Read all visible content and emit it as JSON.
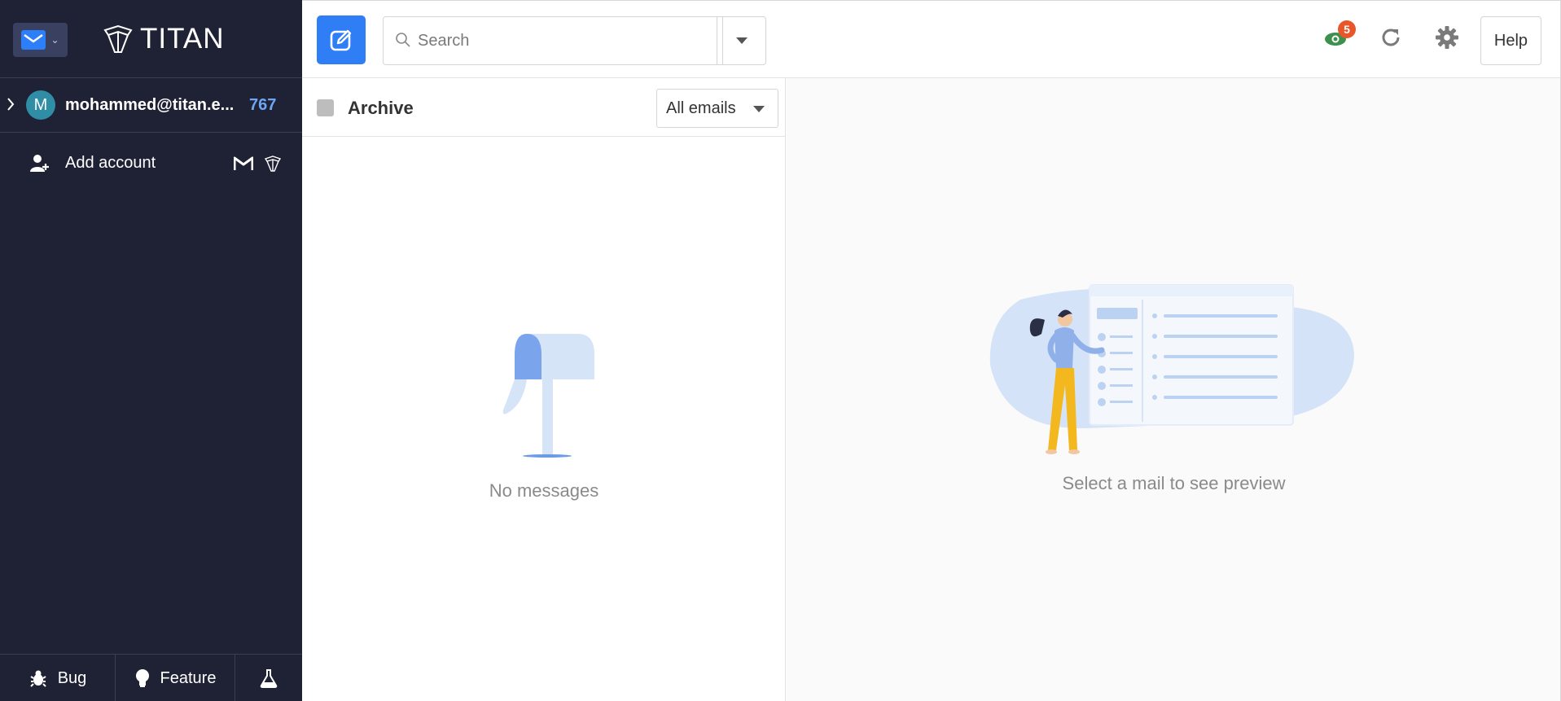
{
  "app": {
    "brand": "TITAN"
  },
  "sidebar": {
    "account": {
      "initial": "M",
      "email": "mohammed@titan.e...",
      "count": "767"
    },
    "add_account_label": "Add account",
    "bottom": {
      "bug_label": "Bug",
      "feature_label": "Feature"
    }
  },
  "header": {
    "search": {
      "placeholder": "Search",
      "value": ""
    },
    "notification_count": "5",
    "help_label": "Help"
  },
  "list": {
    "folder": "Archive",
    "filter_selected": "All emails",
    "empty_text": "No messages"
  },
  "preview": {
    "empty_text": "Select a mail to see preview"
  },
  "colors": {
    "accent": "#2f7ef5",
    "sidebar_bg": "#1f2235",
    "badge": "#e8562a",
    "count": "#6ea6f5"
  }
}
